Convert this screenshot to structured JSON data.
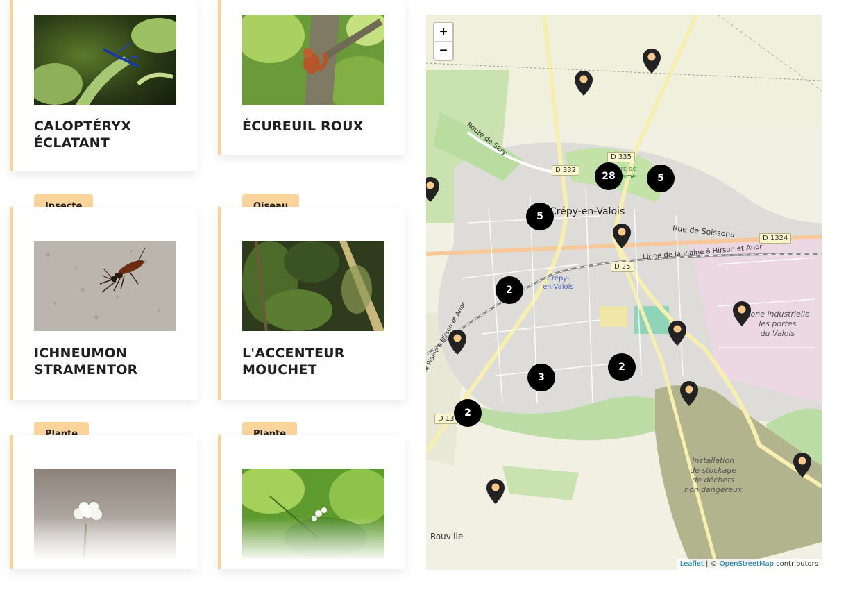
{
  "cards": [
    {
      "title": "CALOPTÉRYX ÉCLATANT",
      "category": "",
      "image": "damselfly-photo"
    },
    {
      "title": "ÉCUREUIL ROUX",
      "category": "",
      "image": "red-squirrel-photo"
    },
    {
      "title": "ICHNEUMON STRAMENTOR",
      "category": "Insecte",
      "image": "wasp-photo"
    },
    {
      "title": "L'ACCENTEUR MOUCHET",
      "category": "Oiseau",
      "image": "forest-bird-photo"
    },
    {
      "title": "",
      "category": "Plante",
      "image": "white-flower-photo"
    },
    {
      "title": "",
      "category": "Plante",
      "image": "green-plant-photo"
    }
  ],
  "map": {
    "zoom_in_label": "+",
    "zoom_out_label": "−",
    "place_labels": {
      "town": "Crépy-en-Valois",
      "station": "Crépy-\nen-Valois",
      "industrial_zone": "Zone industrielle\nles portes\ndu Valois",
      "waste_site": "Installation\nde stockage\nde déchets\nnon dangereux",
      "village": "Rouville",
      "park": "Parc de\nTresme"
    },
    "road_labels": {
      "d335": "D 335",
      "d332": "D 332",
      "d1324": "D 1324",
      "d25": "D 25",
      "d13": "D 13",
      "route_de_sery": "Route de Sery",
      "rue_de_soissons": "Rue de Soissons",
      "railway": "Ligne de la Plaine à Hirson et Anor",
      "railway_sw": "la Plaine à Hirson et Anor"
    },
    "clusters": [
      "28",
      "5",
      "5",
      "2",
      "3",
      "2",
      "2"
    ],
    "attribution": {
      "leaflet": "Leaflet",
      "separator": "| ©",
      "osm": "OpenStreetMap",
      "suffix": "contributors"
    },
    "colors": {
      "cluster": "#000000",
      "pin": "#222222",
      "pin_dot": "#f8c98a",
      "accent": "#fbd49c"
    }
  }
}
